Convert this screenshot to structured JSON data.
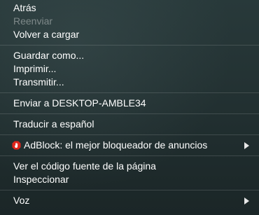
{
  "context_menu": {
    "group1": [
      {
        "label": "Atrás",
        "enabled": true
      },
      {
        "label": "Reenviar",
        "enabled": false
      },
      {
        "label": "Volver a cargar",
        "enabled": true
      }
    ],
    "group2": [
      {
        "label": "Guardar como..."
      },
      {
        "label": "Imprimir..."
      },
      {
        "label": "Transmitir..."
      }
    ],
    "group3": [
      {
        "label": "Enviar a DESKTOP-AMBLE34"
      }
    ],
    "group4": [
      {
        "label": "Traducir a español"
      }
    ],
    "group5": [
      {
        "label": "AdBlock: el mejor bloqueador de anuncios",
        "icon": "adblock-hand-icon",
        "submenu": true
      }
    ],
    "group6": [
      {
        "label": "Ver el código fuente de la página"
      },
      {
        "label": "Inspeccionar"
      }
    ],
    "group7": [
      {
        "label": "Voz",
        "submenu": true
      }
    ]
  },
  "colors": {
    "text": "#ffffff",
    "disabled_text": "#8a9393",
    "adblock_red": "#e0251b"
  }
}
